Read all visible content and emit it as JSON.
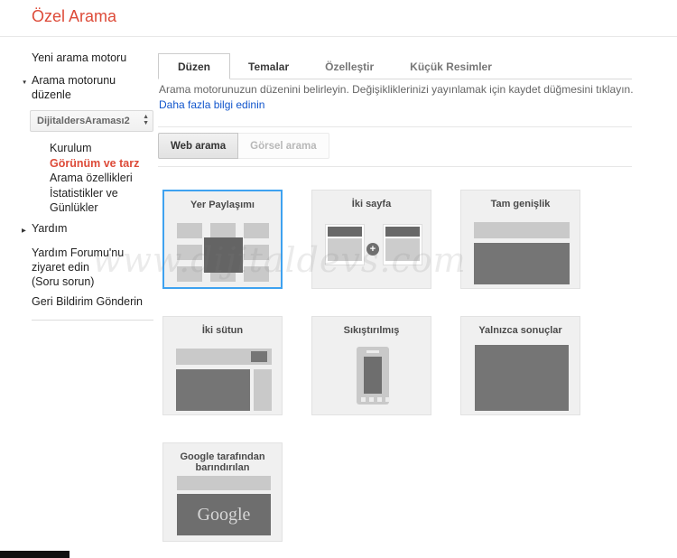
{
  "page": {
    "title": "Özel Arama"
  },
  "icons": {
    "triangle_down": "▼",
    "triangle_right": "▶",
    "spinner_up": "▲",
    "spinner_down": "▼",
    "plus": "+"
  },
  "sidebar": {
    "new_engine": "Yeni arama motoru",
    "edit_engine": "Arama motorunu düzenle",
    "engine_select_value": "DijitaldersAraması2",
    "sub_items": [
      {
        "label": "Kurulum",
        "active": false
      },
      {
        "label": "Görünüm ve tarz",
        "active": true
      },
      {
        "label": "Arama özellikleri",
        "active": false
      },
      {
        "label": "İstatistikler ve Günlükler",
        "active": false
      }
    ],
    "help": "Yardım",
    "help_forum": "Yardım Forumu'nu ziyaret edin",
    "help_forum_note": "(Soru sorun)",
    "feedback": "Geri Bildirim Gönderin"
  },
  "tabs": [
    {
      "label": "Düzen",
      "active": true
    },
    {
      "label": "Temalar",
      "active": false
    },
    {
      "label": "Özelleştir",
      "active": false
    },
    {
      "label": "Küçük Resimler",
      "active": false
    }
  ],
  "main": {
    "description": "Arama motorunuzun düzenini belirleyin. Değişikliklerinizi yayınlamak için kaydet düğmesini tıklayın.",
    "learn_more": "Daha fazla bilgi edinin",
    "search_type_toggle": [
      {
        "label": "Web arama",
        "active": true
      },
      {
        "label": "Görsel arama",
        "active": false
      }
    ],
    "layouts": [
      {
        "name": "Yer Paylaşımı",
        "selected": true,
        "type": "overlay"
      },
      {
        "name": "İki sayfa",
        "selected": false,
        "type": "two-page"
      },
      {
        "name": "Tam genişlik",
        "selected": false,
        "type": "full-width"
      },
      {
        "name": "İki sütun",
        "selected": false,
        "type": "two-column"
      },
      {
        "name": "Sıkıştırılmış",
        "selected": false,
        "type": "compact"
      },
      {
        "name": "Yalnızca sonuçlar",
        "selected": false,
        "type": "results-only"
      },
      {
        "name": "Google tarafından barındırılan",
        "selected": false,
        "type": "google-hosted",
        "logo": "Google"
      }
    ]
  },
  "watermark": "www.dijitaldevs.com",
  "colors": {
    "accent_red": "#dd4b39",
    "link_blue": "#1155cc",
    "selected_card_blue": "#3ea2f0",
    "dark_block": "#6f6f6f",
    "light_block": "#c9c9c9"
  }
}
